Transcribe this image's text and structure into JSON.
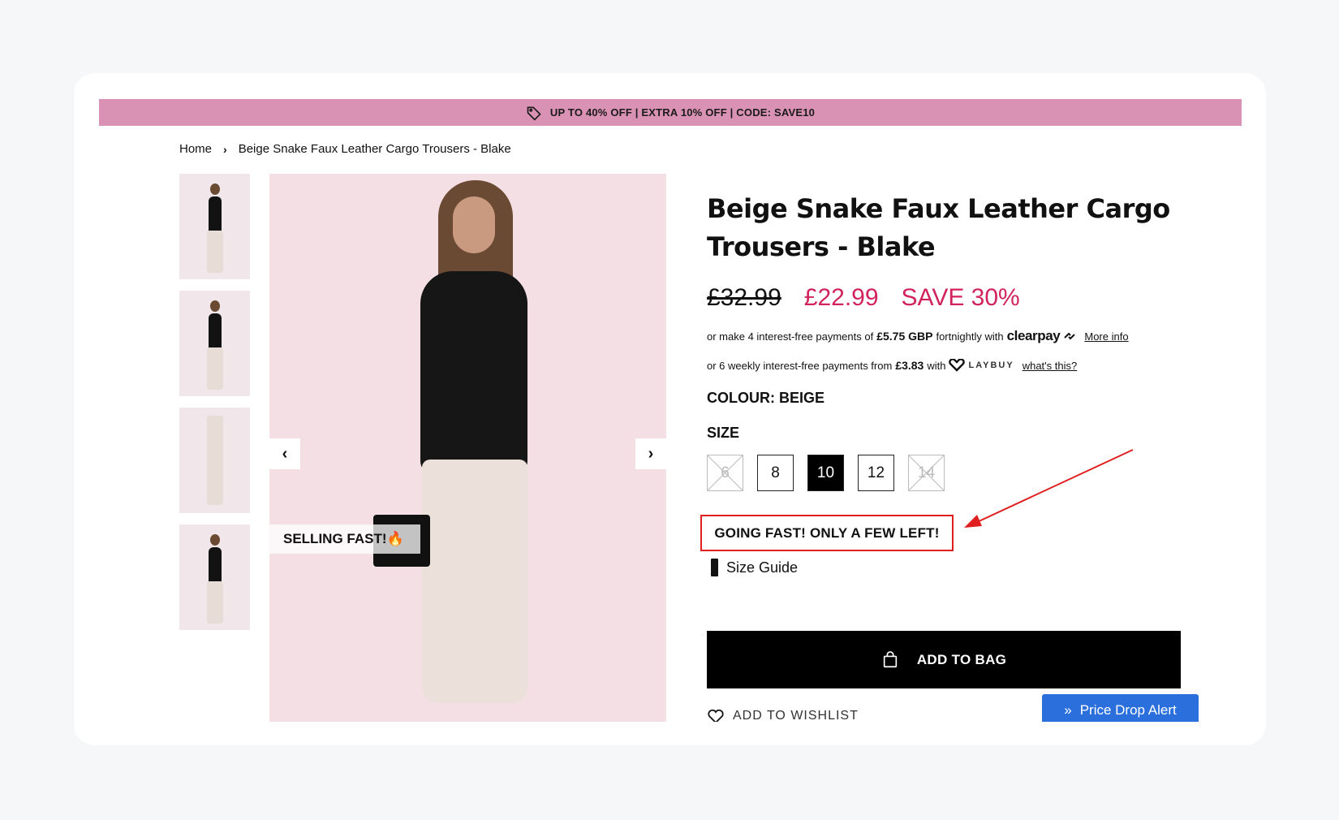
{
  "promo": {
    "text": "UP TO 40% OFF | EXTRA 10% OFF | CODE: SAVE10",
    "icon": "tag-icon",
    "background": "#d991b4"
  },
  "breadcrumb": {
    "home": "Home",
    "separator": "›",
    "current": "Beige Snake Faux Leather Cargo Trousers - Blake"
  },
  "gallery": {
    "thumbnail_count": 4,
    "badge": "SELLING FAST!🔥",
    "prev_icon": "chevron-left-icon",
    "next_icon": "chevron-right-icon"
  },
  "product": {
    "title_line1": "Beige Snake Faux Leather Cargo",
    "title_line2": "Trousers - Blake",
    "old_price": "£32.99",
    "new_price": "£22.99",
    "save": "SAVE 30%",
    "sale_color": "#d1245c",
    "clearpay": {
      "prefix": "or make 4 interest-free payments of",
      "amount": "£5.75 GBP",
      "middle": "fortnightly with",
      "brand": "clearpay",
      "link": "More info"
    },
    "laybuy": {
      "prefix": "or 6 weekly interest-free payments from",
      "amount": "£3.83",
      "middle": "with",
      "brand": "LAYBUY",
      "link": "what's this?"
    },
    "colour_label": "COLOUR: BEIGE",
    "size_label": "SIZE",
    "sizes": [
      {
        "label": "6",
        "state": "disabled"
      },
      {
        "label": "8",
        "state": "available"
      },
      {
        "label": "10",
        "state": "selected"
      },
      {
        "label": "12",
        "state": "available"
      },
      {
        "label": "14",
        "state": "disabled"
      }
    ],
    "stock_message": "GOING FAST! ONLY A FEW LEFT!",
    "size_guide": "Size Guide",
    "add_to_bag": "ADD TO BAG",
    "wishlist": "ADD TO WISHLIST"
  },
  "price_drop": {
    "label": "Price Drop Alert",
    "color": "#2a6fdc"
  },
  "annotation": {
    "color": "#e02020"
  }
}
